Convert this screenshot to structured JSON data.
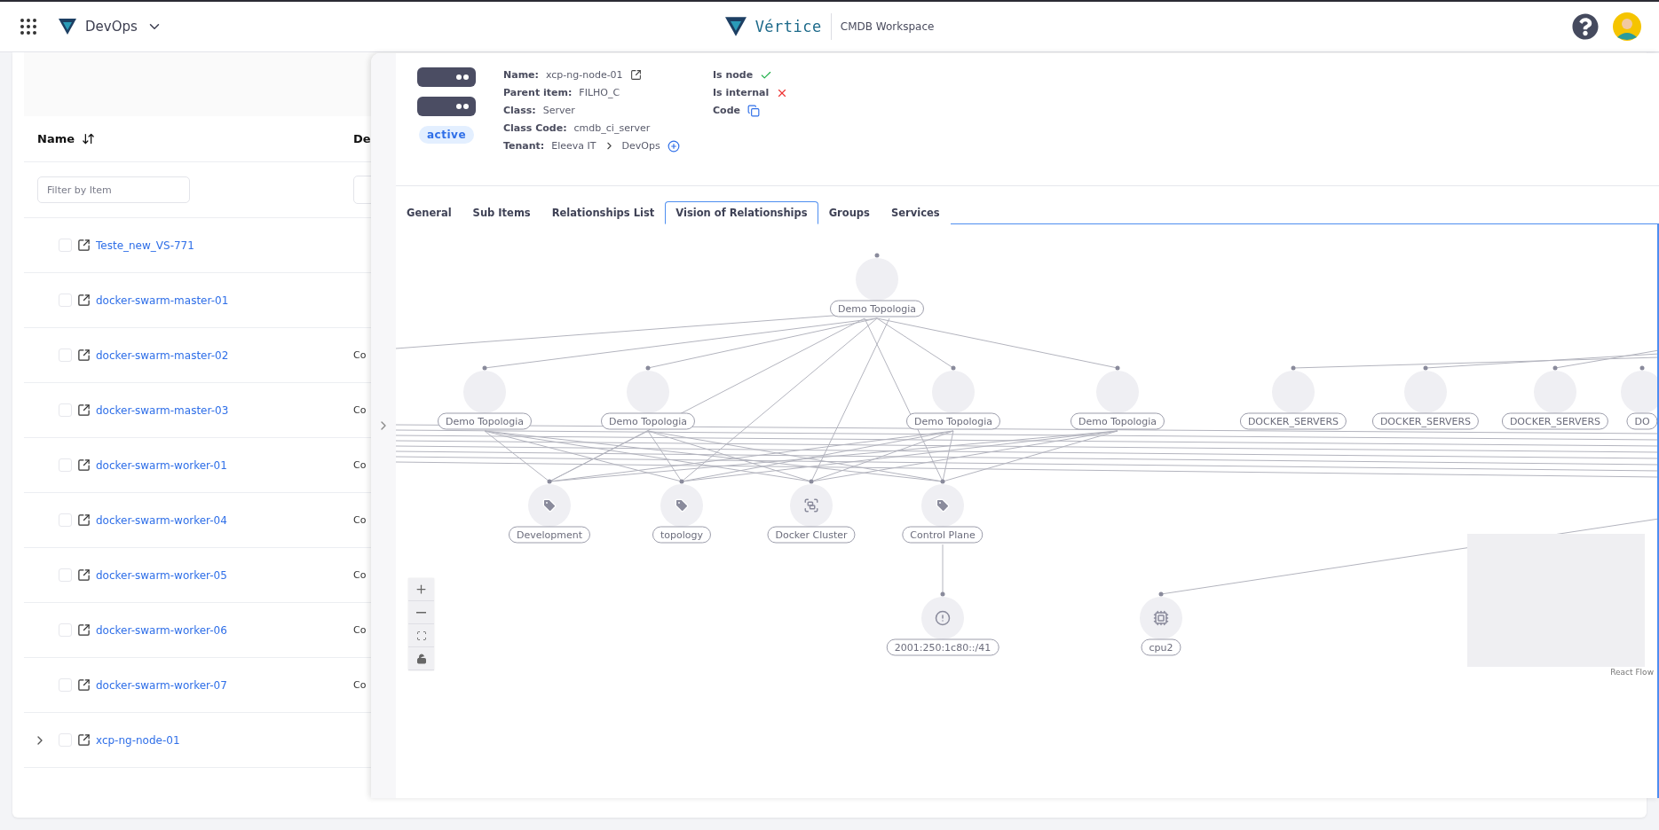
{
  "topbar": {
    "workspace": "DevOps",
    "brand": "Vértice",
    "app_title": "CMDB Workspace"
  },
  "list": {
    "columns": [
      {
        "label": "Name"
      },
      {
        "label": "De"
      }
    ],
    "filter": {
      "placeholder": "Filter by Item"
    },
    "rows": [
      {
        "name": "Teste_new_VS-771",
        "checked": false
      },
      {
        "name": "docker-swarm-master-01",
        "checked": false
      },
      {
        "name": "docker-swarm-master-02",
        "checked": false,
        "column_2": "Co"
      },
      {
        "name": "docker-swarm-master-03",
        "checked": false,
        "column_2": "Co"
      },
      {
        "name": "docker-swarm-worker-01",
        "checked": false,
        "column_2": "Co"
      },
      {
        "name": "docker-swarm-worker-04",
        "checked": false,
        "column_2": "Co"
      },
      {
        "name": "docker-swarm-worker-05",
        "checked": false,
        "column_2": "Co"
      },
      {
        "name": "docker-swarm-worker-06",
        "checked": false,
        "column_2": "Co"
      },
      {
        "name": "docker-swarm-worker-07",
        "checked": false,
        "column_2": "Co"
      },
      {
        "name": "xcp-ng-node-01",
        "checked": false,
        "expanded": false
      }
    ]
  },
  "detail": {
    "status": "active",
    "fields": [
      {
        "label": "Name:",
        "kind": "link",
        "values": [
          "xcp-ng-node-01"
        ]
      },
      {
        "label": "Parent item:",
        "kind": "text",
        "values": [
          "FILHO_C"
        ]
      },
      {
        "label": "Class:",
        "kind": "text",
        "values": [
          "Server"
        ]
      },
      {
        "label": "Class Code:",
        "kind": "text",
        "values": [
          "cmdb_ci_server"
        ]
      },
      {
        "label": "Tenant:",
        "kind": "path",
        "values": [
          "Eleeva IT",
          "DevOps"
        ]
      }
    ],
    "flags": [
      {
        "label": "Is node",
        "kind": "bool",
        "on": true
      },
      {
        "label": "Is internal",
        "kind": "bool",
        "on": false
      },
      {
        "label": "Code",
        "kind": "copy"
      }
    ],
    "tabs": [
      {
        "label": "General",
        "selected": false
      },
      {
        "label": "Sub Items",
        "selected": false
      },
      {
        "label": "Relationships List",
        "selected": false
      },
      {
        "label": "Vision of Relationships",
        "selected": true
      },
      {
        "label": "Groups",
        "selected": false
      },
      {
        "label": "Services",
        "selected": false
      }
    ]
  },
  "graph": {
    "nodes": [
      {
        "label": "Demo Topologia",
        "kind": "plain"
      },
      {
        "label": "Demo Topologia",
        "kind": "plain"
      },
      {
        "label": "Demo Topologia",
        "kind": "plain"
      },
      {
        "label": "Demo Topologia",
        "kind": "plain"
      },
      {
        "label": "Demo Topologia",
        "kind": "plain"
      },
      {
        "label": "DOCKER_SERVERS",
        "kind": "plain"
      },
      {
        "label": "DOCKER_SERVERS",
        "kind": "plain"
      },
      {
        "label": "DOCKER_SERVERS",
        "kind": "plain"
      },
      {
        "label": "DO",
        "kind": "plain"
      },
      {
        "label": "Development",
        "kind": "tag"
      },
      {
        "label": "topology",
        "kind": "tag"
      },
      {
        "label": "Docker Cluster",
        "kind": "cluster"
      },
      {
        "label": "Control Plane",
        "kind": "tag"
      },
      {
        "label": "2001:250:1c80::/41",
        "kind": "alert"
      },
      {
        "label": "cpu2",
        "kind": "chip"
      }
    ],
    "attribution": "React Flow"
  }
}
